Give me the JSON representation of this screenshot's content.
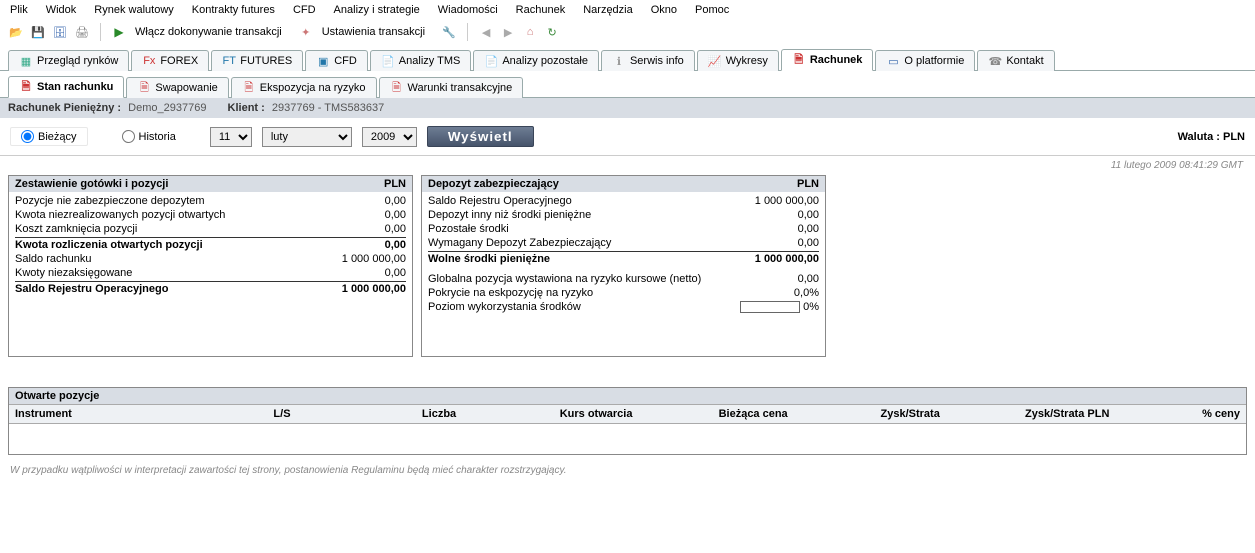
{
  "menu": [
    "Plik",
    "Widok",
    "Rynek walutowy",
    "Kontrakty futures",
    "CFD",
    "Analizy i strategie",
    "Wiadomości",
    "Rachunek",
    "Narzędzia",
    "Okno",
    "Pomoc"
  ],
  "toolbar": {
    "action1": "Włącz dokonywanie transakcji",
    "action2": "Ustawienia transakcji"
  },
  "main_tabs": [
    {
      "label": "Przegląd rynków"
    },
    {
      "label": "FOREX"
    },
    {
      "label": "FUTURES"
    },
    {
      "label": "CFD"
    },
    {
      "label": "Analizy TMS"
    },
    {
      "label": "Analizy pozostałe"
    },
    {
      "label": "Serwis info"
    },
    {
      "label": "Wykresy"
    },
    {
      "label": "Rachunek",
      "active": true
    },
    {
      "label": "O platformie"
    },
    {
      "label": "Kontakt"
    }
  ],
  "sub_tabs": [
    {
      "label": "Stan rachunku",
      "active": true
    },
    {
      "label": "Swapowanie"
    },
    {
      "label": "Ekspozycja na ryzyko"
    },
    {
      "label": "Warunki transakcyjne"
    }
  ],
  "account": {
    "label1": "Rachunek Pieniężny :",
    "val1": "Demo_2937769",
    "label2": "Klient :",
    "val2": "2937769 - TMS583637"
  },
  "filter": {
    "radio_current": "Bieżący",
    "radio_history": "Historia",
    "day": "11",
    "month": "luty",
    "year": "2009",
    "button": "Wyświetl",
    "currency_label": "Waluta : PLN"
  },
  "timestamp": "11 lutego 2009 08:41:29 GMT",
  "panel_left": {
    "title": "Zestawienie gotówki i pozycji",
    "currency": "PLN",
    "rows": [
      {
        "l": "Pozycje nie zabezpieczone depozytem",
        "v": "0,00"
      },
      {
        "l": "Kwota niezrealizowanych pozycji otwartych",
        "v": "0,00"
      },
      {
        "l": "Koszt zamknięcia pozycji",
        "v": "0,00"
      }
    ],
    "sum1": {
      "l": "Kwota rozliczenia otwartych pozycji",
      "v": "0,00"
    },
    "rows2": [
      {
        "l": "Saldo rachunku",
        "v": "1 000 000,00"
      },
      {
        "l": "Kwoty niezaksięgowane",
        "v": "0,00"
      }
    ],
    "sum2": {
      "l": "Saldo Rejestru Operacyjnego",
      "v": "1 000 000,00"
    }
  },
  "panel_right": {
    "title": "Depozyt zabezpieczający",
    "currency": "PLN",
    "rows": [
      {
        "l": "Saldo Rejestru Operacyjnego",
        "v": "1 000 000,00"
      },
      {
        "l": "Depozyt inny niż środki pieniężne",
        "v": "0,00"
      },
      {
        "l": "Pozostałe środki",
        "v": "0,00"
      },
      {
        "l": "Wymagany Depozyt Zabezpieczający",
        "v": "0,00"
      }
    ],
    "sum1": {
      "l": "Wolne środki pieniężne",
      "v": "1 000 000,00"
    },
    "rows2": [
      {
        "l": "Globalna pozycja wystawiona na ryzyko kursowe (netto)",
        "v": "0,00"
      },
      {
        "l": "Pokrycie na eskpozycję na ryzyko",
        "v": "0,0%"
      },
      {
        "l": "Poziom wykorzystania środków",
        "v": "0%",
        "progress": true
      }
    ]
  },
  "positions": {
    "title": "Otwarte pozycje",
    "cols": [
      "Instrument",
      "L/S",
      "Liczba",
      "Kurs otwarcia",
      "Bieżąca cena",
      "Zysk/Strata",
      "Zysk/Strata PLN",
      "% ceny"
    ]
  },
  "disclaimer": "W przypadku wątpliwości w interpretacji zawartości tej strony, postanowienia Regulaminu będą mieć charakter rozstrzygający."
}
